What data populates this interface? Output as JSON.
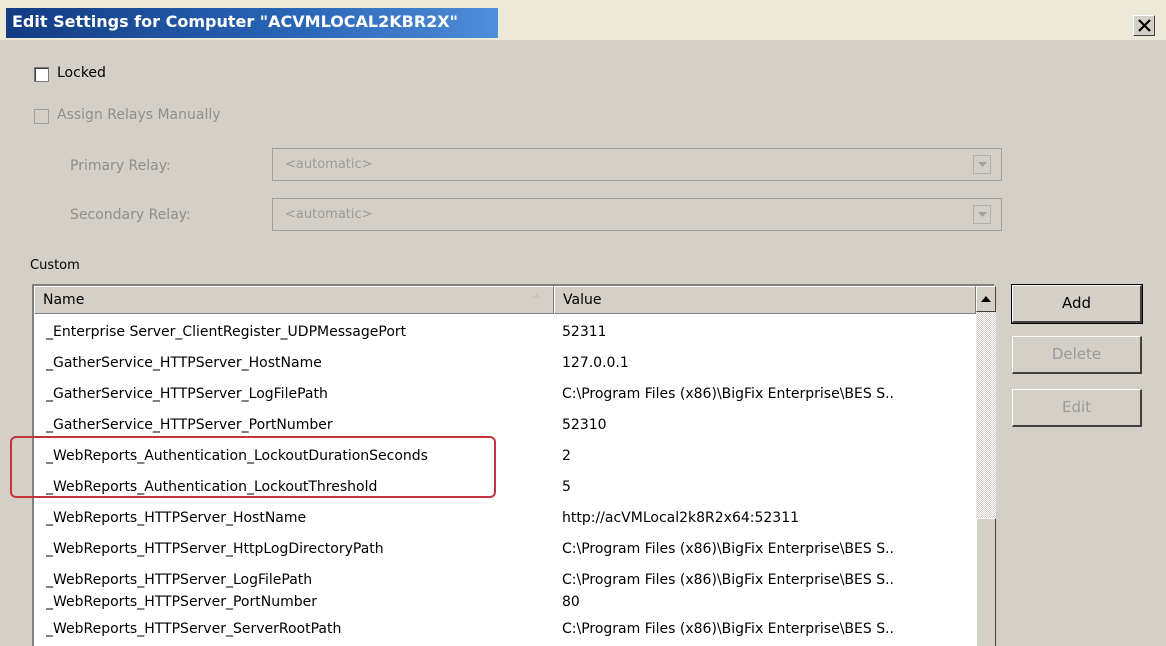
{
  "window": {
    "title": "Edit Settings for Computer \"ACVMLOCAL2KBR2X\"",
    "close_glyph": "✕"
  },
  "locked": {
    "label": "Locked",
    "checked": false
  },
  "assign_relays": {
    "label": "Assign Relays Manually",
    "checked": false,
    "enabled": false
  },
  "primary_relay": {
    "label": "Primary Relay:",
    "value": "<automatic>"
  },
  "secondary_relay": {
    "label": "Secondary Relay:",
    "value": "<automatic>"
  },
  "custom": {
    "section_label": "Custom",
    "columns": {
      "name": "Name",
      "value": "Value"
    },
    "rows": [
      {
        "name": "_Enterprise Server_ClientRegister_UDPMessagePort",
        "value": "52311"
      },
      {
        "name": "_GatherService_HTTPServer_HostName",
        "value": "127.0.0.1"
      },
      {
        "name": "_GatherService_HTTPServer_LogFilePath",
        "value": "C:\\Program Files (x86)\\BigFix Enterprise\\BES S.."
      },
      {
        "name": "_GatherService_HTTPServer_PortNumber",
        "value": "52310"
      },
      {
        "name": "_WebReports_Authentication_LockoutDurationSeconds",
        "value": "2"
      },
      {
        "name": "_WebReports_Authentication_LockoutThreshold",
        "value": "5"
      },
      {
        "name": "_WebReports_HTTPServer_HostName",
        "value": "http://acVMLocal2k8R2x64:52311"
      },
      {
        "name": "_WebReports_HTTPServer_HttpLogDirectoryPath",
        "value": "C:\\Program Files (x86)\\BigFix Enterprise\\BES S.."
      },
      {
        "name": "_WebReports_HTTPServer_LogFilePath",
        "value": "C:\\Program Files (x86)\\BigFix Enterprise\\BES S.."
      },
      {
        "name": "_WebReports_HTTPServer_PortNumber",
        "value": "80"
      },
      {
        "name": "_WebReports_HTTPServer_ServerRootPath",
        "value": "C:\\Program Files (x86)\\BigFix Enterprise\\BES S.."
      }
    ]
  },
  "buttons": {
    "add": "Add",
    "delete": "Delete",
    "edit": "Edit"
  },
  "colors": {
    "title_bar": "#123c82",
    "dialog_bg": "#d4d0c8",
    "highlight_outline": "#c4343c"
  },
  "icons": {
    "close": "close-icon",
    "dropdown": "chevron-down-icon",
    "scroll_up": "scroll-up-arrow-icon"
  }
}
